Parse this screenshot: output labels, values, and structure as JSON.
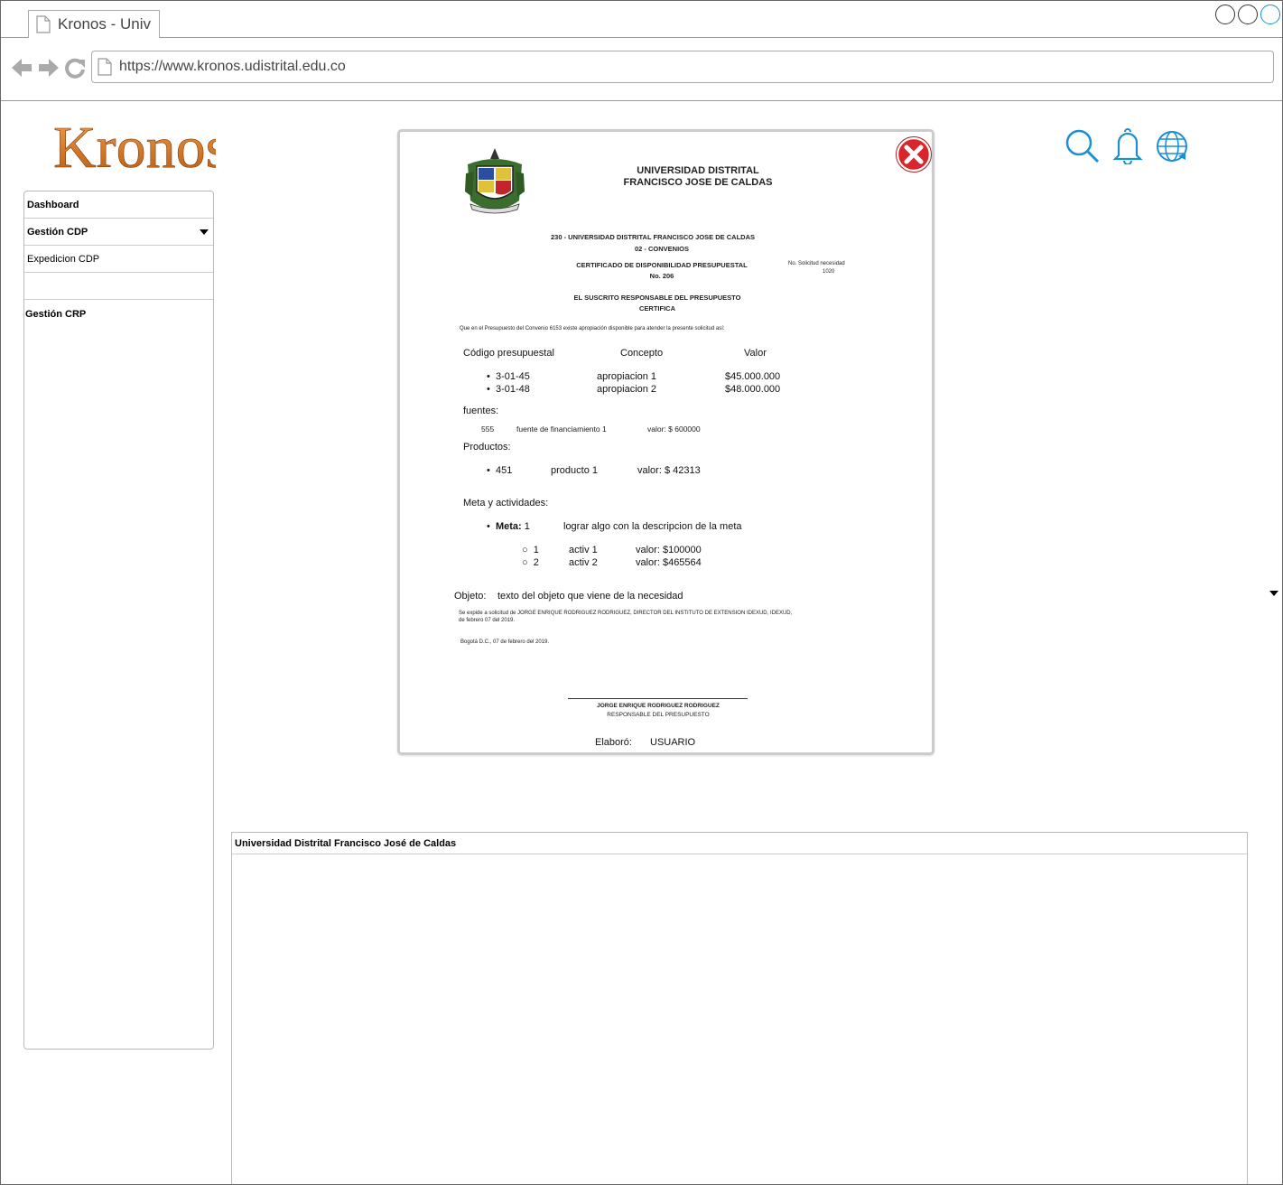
{
  "browser": {
    "tab_title": "Kronos - Univ",
    "url": "https://www.kronos.udistrital.edu.co"
  },
  "logo_text": "Kronos",
  "sidebar": {
    "items": [
      {
        "label": "Dashboard"
      },
      {
        "label": "Gestión CDP"
      },
      {
        "label": "Expedicion CDP"
      }
    ],
    "section": "Gestión CRP"
  },
  "document": {
    "uni_line1": "UNIVERSIDAD DISTRITAL",
    "uni_line2": "FRANCISCO JOSE DE CALDAS",
    "entity_line": "230 - UNIVERSIDAD DISTRITAL FRANCISCO JOSE DE CALDAS",
    "convenio_line": "02 - CONVENIOS",
    "cert_title": "CERTIFICADO DE DISPONIBILIDAD PRESUPUESTAL",
    "cert_no": "No.  206",
    "solicitud_label": "No. Solicitud necesidad",
    "solicitud_value": "1020",
    "suscrito": "EL SUSCRITO RESPONSABLE DEL PRESUPUESTO",
    "certifica": "CERTIFICA",
    "intro": "Que en el Presupuesto del Convenio 6153 existe apropiación disponible para atender la presente solicitud así:",
    "col_codigo": "Código presupuestal",
    "col_concepto": "Concepto",
    "col_valor": "Valor",
    "rubros": [
      {
        "codigo": "3-01-45",
        "concepto": "apropiacion 1",
        "valor": "$45.000.000"
      },
      {
        "codigo": "3-01-48",
        "concepto": "apropiacion 2",
        "valor": "$48.000.000"
      }
    ],
    "fuentes_label": "fuentes:",
    "fuente": {
      "codigo": "555",
      "nombre": "fuente de financiamiento 1",
      "valor": "valor: $ 600000"
    },
    "productos_label": "Productos:",
    "producto": {
      "codigo": "451",
      "nombre": "producto 1",
      "valor": "valor: $ 42313"
    },
    "metas_label": "Meta y actividades:",
    "meta_label": "Meta:",
    "meta_num": "1",
    "meta_desc": "lograr algo con la descripcion de la meta",
    "actividades": [
      {
        "num": "1",
        "nombre": "activ 1",
        "valor": "valor: $100000"
      },
      {
        "num": "2",
        "nombre": "activ 2",
        "valor": "valor: $465564"
      }
    ],
    "objeto_label": "Objeto:",
    "objeto_text": "texto del objeto que viene de la necesidad",
    "expide_line1": "Se expide a solicitud de JORGE ENRIQUE RODRIGUEZ RODRIGUEZ, DIRECTOR DEL INSTITUTO DE EXTENSION IDEXUD, IDEXUD,",
    "expide_line2": "de febrero 07 del 2019.",
    "fecha": "Bogotá D.C., 07 de febrero del 2019.",
    "firma_nombre": "JORGE ENRIQUE RODRIGUEZ RODRIGUEZ",
    "firma_cargo": "RESPONSABLE DEL PRESUPUESTO",
    "elaboro_label": "Elaboró:",
    "elaboro_value": "USUARIO"
  },
  "bottom_panel": {
    "header": "Universidad Distrital Francisco José de Caldas"
  },
  "colors": {
    "accent_blue": "#1a8fd6",
    "close_red": "#d9262c",
    "logo_orange": "#e07d1a"
  },
  "icons": [
    "document-icon",
    "back-arrow-icon",
    "forward-arrow-icon",
    "reload-icon",
    "search-icon",
    "bell-icon",
    "globe-icon",
    "close-icon",
    "crest-icon"
  ]
}
